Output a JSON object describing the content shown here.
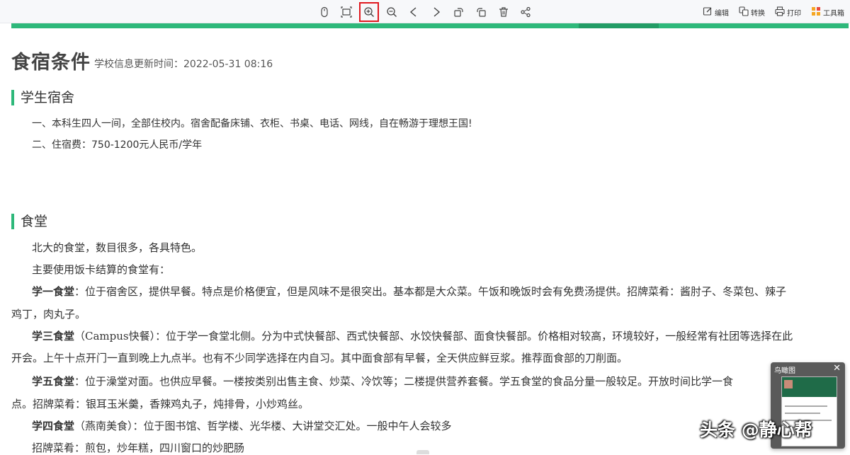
{
  "toolbar": {
    "center_icons": [
      "mouse-icon",
      "fit-screen-icon",
      "zoom-in-icon",
      "zoom-out-icon",
      "previous-icon",
      "next-icon",
      "rotate-left-icon",
      "rotate-right-icon",
      "delete-icon",
      "share-icon"
    ],
    "active_icon": "zoom-in-icon",
    "edit_label": "编辑",
    "convert_label": "转换",
    "print_label": "打印",
    "toolbox_label": "工具箱"
  },
  "page": {
    "title": "食宿条件",
    "update_info": "学校信息更新时间：2022-05-31 08:16"
  },
  "dorm": {
    "heading": "学生宿舍",
    "line1": "一、本科生四人一间，全部住校内。宿舍配备床铺、衣柜、书桌、电话、网线，自在畅游于理想王国!",
    "line2": "二、住宿费：750-1200元人民币/学年"
  },
  "canteen": {
    "heading": "食堂",
    "intro1": "北大的食堂，数目很多，各具特色。",
    "intro2": "主要使用饭卡结算的食堂有：",
    "items": [
      {
        "name": "学一食堂",
        "line1": "：位于宿舍区，提供早餐。特点是价格便宜，但是风味不是很突出。基本都是大众菜。午饭和晚饭时会有免费汤提供。招牌菜肴：酱肘子、冬菜包、辣子",
        "line2": "鸡丁，肉丸子。"
      },
      {
        "name": "学三食堂",
        "line1": "（Campus快餐）：位于学一食堂北侧。分为中式快餐部、西式快餐部、水饺快餐部、面食快餐部。价格相对较高，环境较好，一般经常有社团等选择在此",
        "line2": "开会。上午十点开门一直到晚上九点半。也有不少同学选择在内自习。其中面食部有早餐，全天供应鲜豆浆。推荐面食部的刀削面。"
      },
      {
        "name": "学五食堂",
        "line1": "：位于澡堂对面。也供应早餐。一楼按类别出售主食、炒菜、冷饮等；二楼提供营养套餐。学五食堂的食品分量一般较足。开放时间比学一食",
        "line2": "点。招牌菜肴：银耳玉米羹，香辣鸡丸子，炖排骨，小炒鸡丝。"
      },
      {
        "name": "学四食堂",
        "line1": "（燕南美食）：位于图书馆、哲学楼、光华楼、大讲堂交汇处。一般中午人会较多",
        "line2": "招牌菜肴：煎包，炒年糕，四川窗口的炒肥肠"
      }
    ]
  },
  "overview": {
    "title": "鸟瞰图",
    "close": "✕"
  },
  "watermark": "头条 @静心帮",
  "colors": {
    "accent": "#2eb87a",
    "highlight": "#e0191f"
  }
}
